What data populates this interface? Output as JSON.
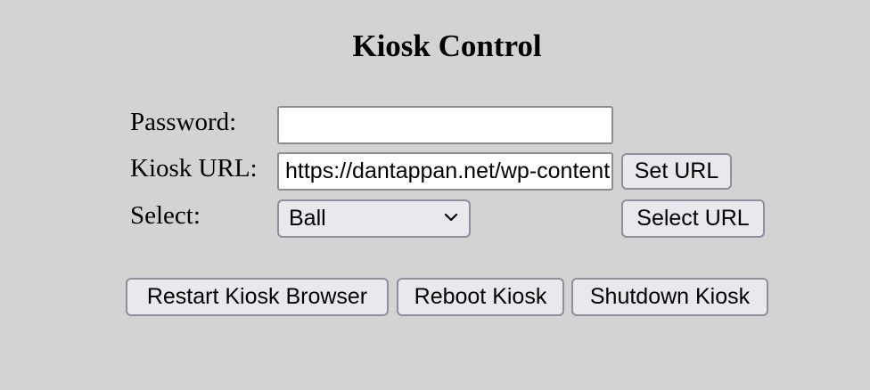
{
  "page": {
    "title": "Kiosk Control"
  },
  "form": {
    "password_label": "Password:",
    "password_value": "",
    "url_label": "Kiosk URL:",
    "url_value": "https://dantappan.net/wp-content",
    "select_label": "Select:",
    "select_value": "Ball",
    "set_url_button": "Set URL",
    "select_url_button": "Select URL"
  },
  "actions": {
    "restart_button": "Restart Kiosk Browser",
    "reboot_button": "Reboot Kiosk",
    "shutdown_button": "Shutdown Kiosk"
  },
  "icons": {
    "select_arrow": "chevron-down-icon"
  }
}
